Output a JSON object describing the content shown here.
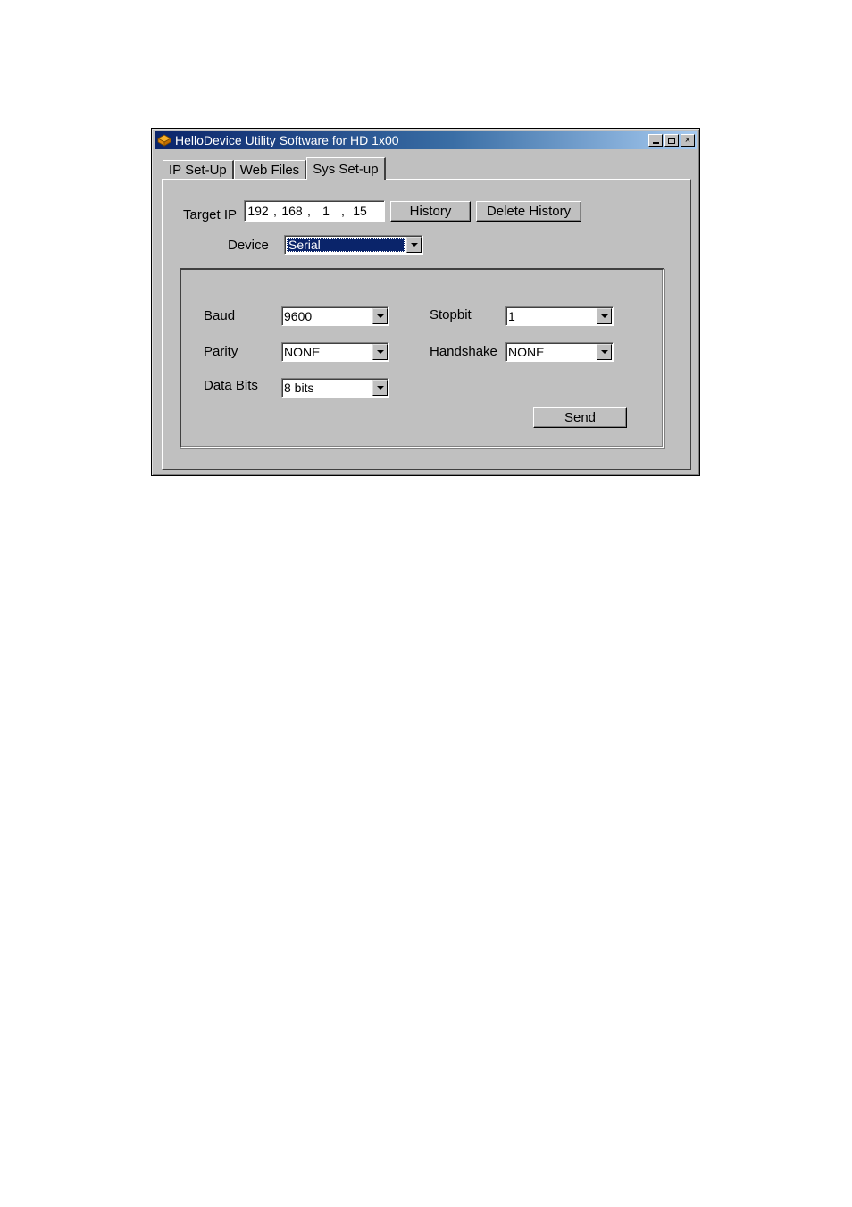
{
  "window": {
    "title": "HelloDevice Utility Software for HD 1x00",
    "controls": {
      "minimize": "minimize-icon",
      "maximize": "maximize-icon",
      "close": "×"
    }
  },
  "tabs": [
    {
      "label": "IP Set-Up",
      "active": false
    },
    {
      "label": "Web Files",
      "active": false
    },
    {
      "label": "Sys Set-up",
      "active": true
    }
  ],
  "target_ip": {
    "label": "Target IP",
    "octets": [
      "192",
      "168",
      "1",
      "15"
    ],
    "separator": ","
  },
  "buttons": {
    "history": "History",
    "delete_history": "Delete History",
    "send": "Send"
  },
  "device": {
    "label": "Device",
    "value": "Serial"
  },
  "serial": {
    "baud": {
      "label": "Baud",
      "value": "9600"
    },
    "parity": {
      "label": "Parity",
      "value": "NONE"
    },
    "data_bits": {
      "label": "Data Bits",
      "value": "8 bits"
    },
    "stopbit": {
      "label": "Stopbit",
      "value": "1"
    },
    "handshake": {
      "label": "Handshake",
      "value": "NONE"
    }
  },
  "colors": {
    "title_bar_start": "#0a246a",
    "title_bar_end": "#a6caf0",
    "face": "#c0c0c0",
    "selection": "#0a246a"
  }
}
